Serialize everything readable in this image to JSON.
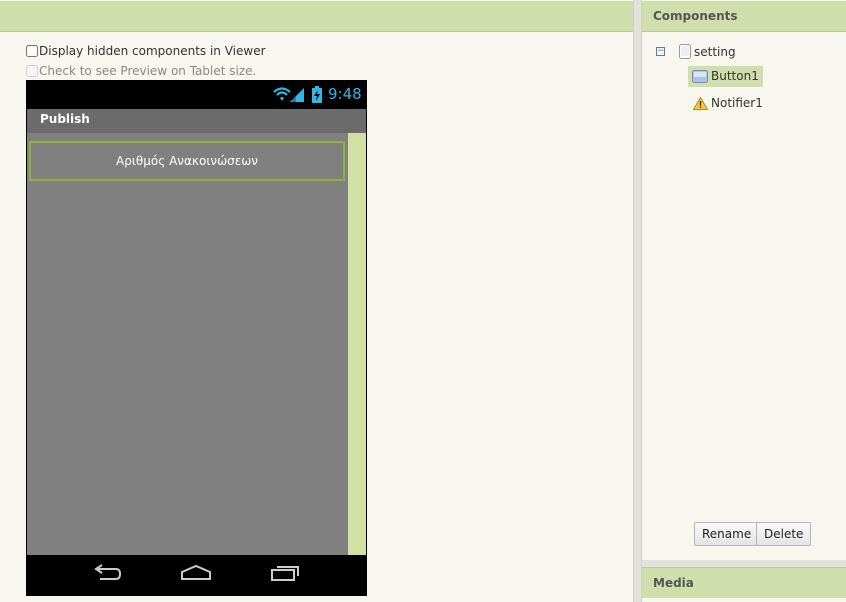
{
  "viewer": {
    "display_hidden_label": "Display hidden components in Viewer",
    "tablet_preview_label": "Check to see Preview on Tablet size."
  },
  "phone": {
    "clock": "9:48",
    "title": "Publish",
    "button_text": "Αριθμός Ανακοινώσεων"
  },
  "components": {
    "title": "Components",
    "tree": [
      {
        "label": "setting"
      },
      {
        "label": "Button1",
        "selected": true
      },
      {
        "label": "Notifier1"
      }
    ],
    "rename_label": "Rename",
    "delete_label": "Delete"
  },
  "media": {
    "title": "Media"
  },
  "colors": {
    "header_green": "#cfdeaa",
    "clock_blue": "#33b5e5",
    "selection_border": "#8db33a"
  }
}
